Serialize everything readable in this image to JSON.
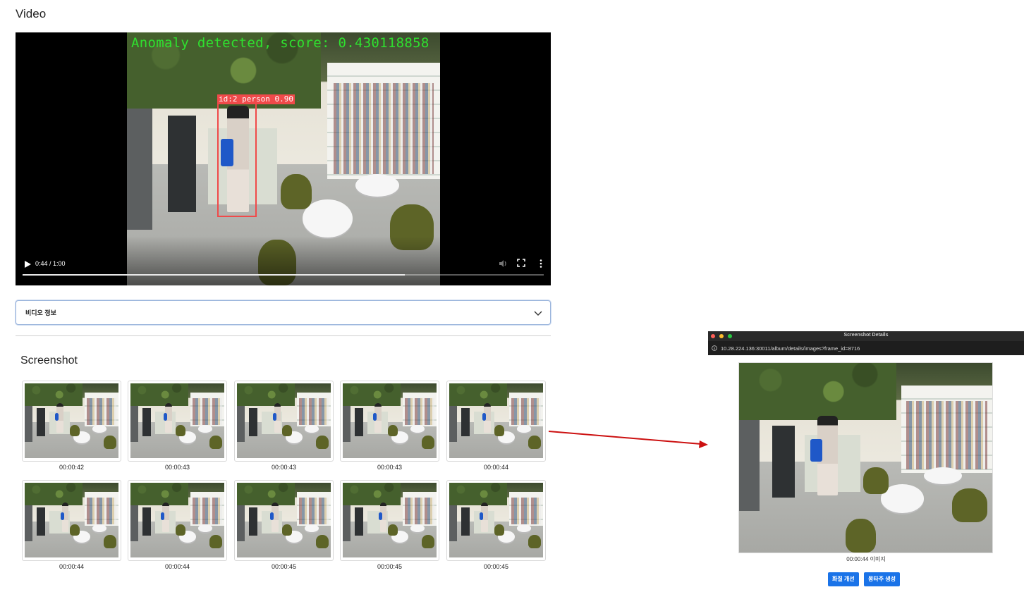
{
  "video": {
    "heading": "Video",
    "overlay_text": "Anomaly detected, score: 0.430118858",
    "bbox_label": "id:2  person 0.90",
    "time_display": "0:44 / 1:00",
    "progress_fraction": 0.733,
    "icons": {
      "play": "play-icon",
      "volume": "volume-icon",
      "fullscreen": "fullscreen-icon",
      "more": "more-icon"
    }
  },
  "accordion": {
    "label": "비디오 정보",
    "icon": "chevron-down-icon"
  },
  "screenshot": {
    "heading": "Screenshot",
    "thumbnails": [
      {
        "time": "00:00:42"
      },
      {
        "time": "00:00:43"
      },
      {
        "time": "00:00:43"
      },
      {
        "time": "00:00:43"
      },
      {
        "time": "00:00:44"
      },
      {
        "time": "00:00:44"
      },
      {
        "time": "00:00:44"
      },
      {
        "time": "00:00:45"
      },
      {
        "time": "00:00:45"
      },
      {
        "time": "00:00:45"
      }
    ]
  },
  "details_window": {
    "title": "Screenshot Details",
    "url": "10.28.224.136:30011/album/details/images?frame_id=8716",
    "caption": "00:00:44 이미지",
    "buttons": [
      "화질 개선",
      "몽타주 생성"
    ]
  },
  "colors": {
    "overlay_green": "#2fe02f",
    "bbox_red": "#f04a4a",
    "button_blue": "#1a73e8",
    "arrow_red": "#cc1111"
  }
}
